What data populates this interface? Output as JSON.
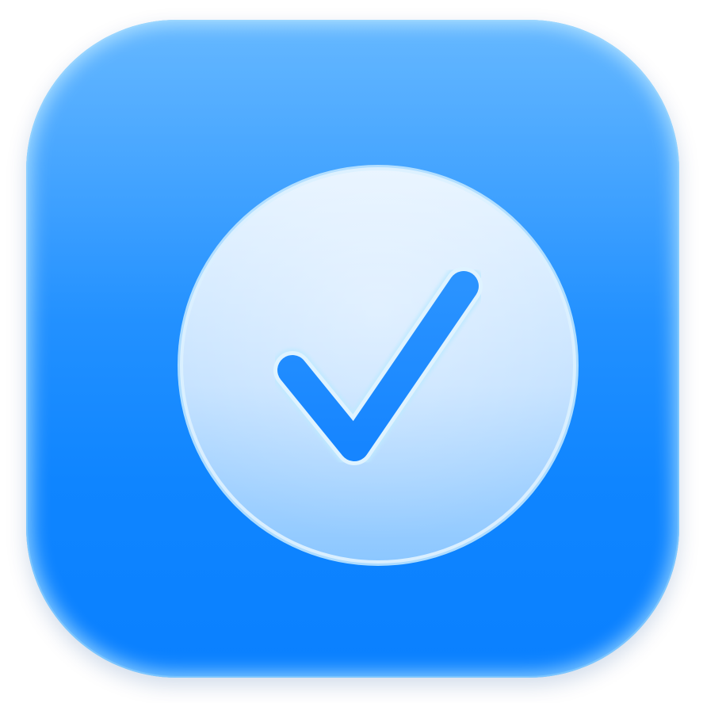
{
  "icon": {
    "name": "checkmark-app-icon",
    "glyph": "checkmark",
    "colors": {
      "tile_top": "#48aaff",
      "tile_bottom": "#0a80ff",
      "tile_rim": "#bfe8ff",
      "disc_top": "#e3f2ff",
      "disc_bottom": "#8cc7ff",
      "disc_rim": "#ffffff",
      "check_fill": "#1d8bff",
      "check_rim": "#b9e6ff"
    }
  }
}
